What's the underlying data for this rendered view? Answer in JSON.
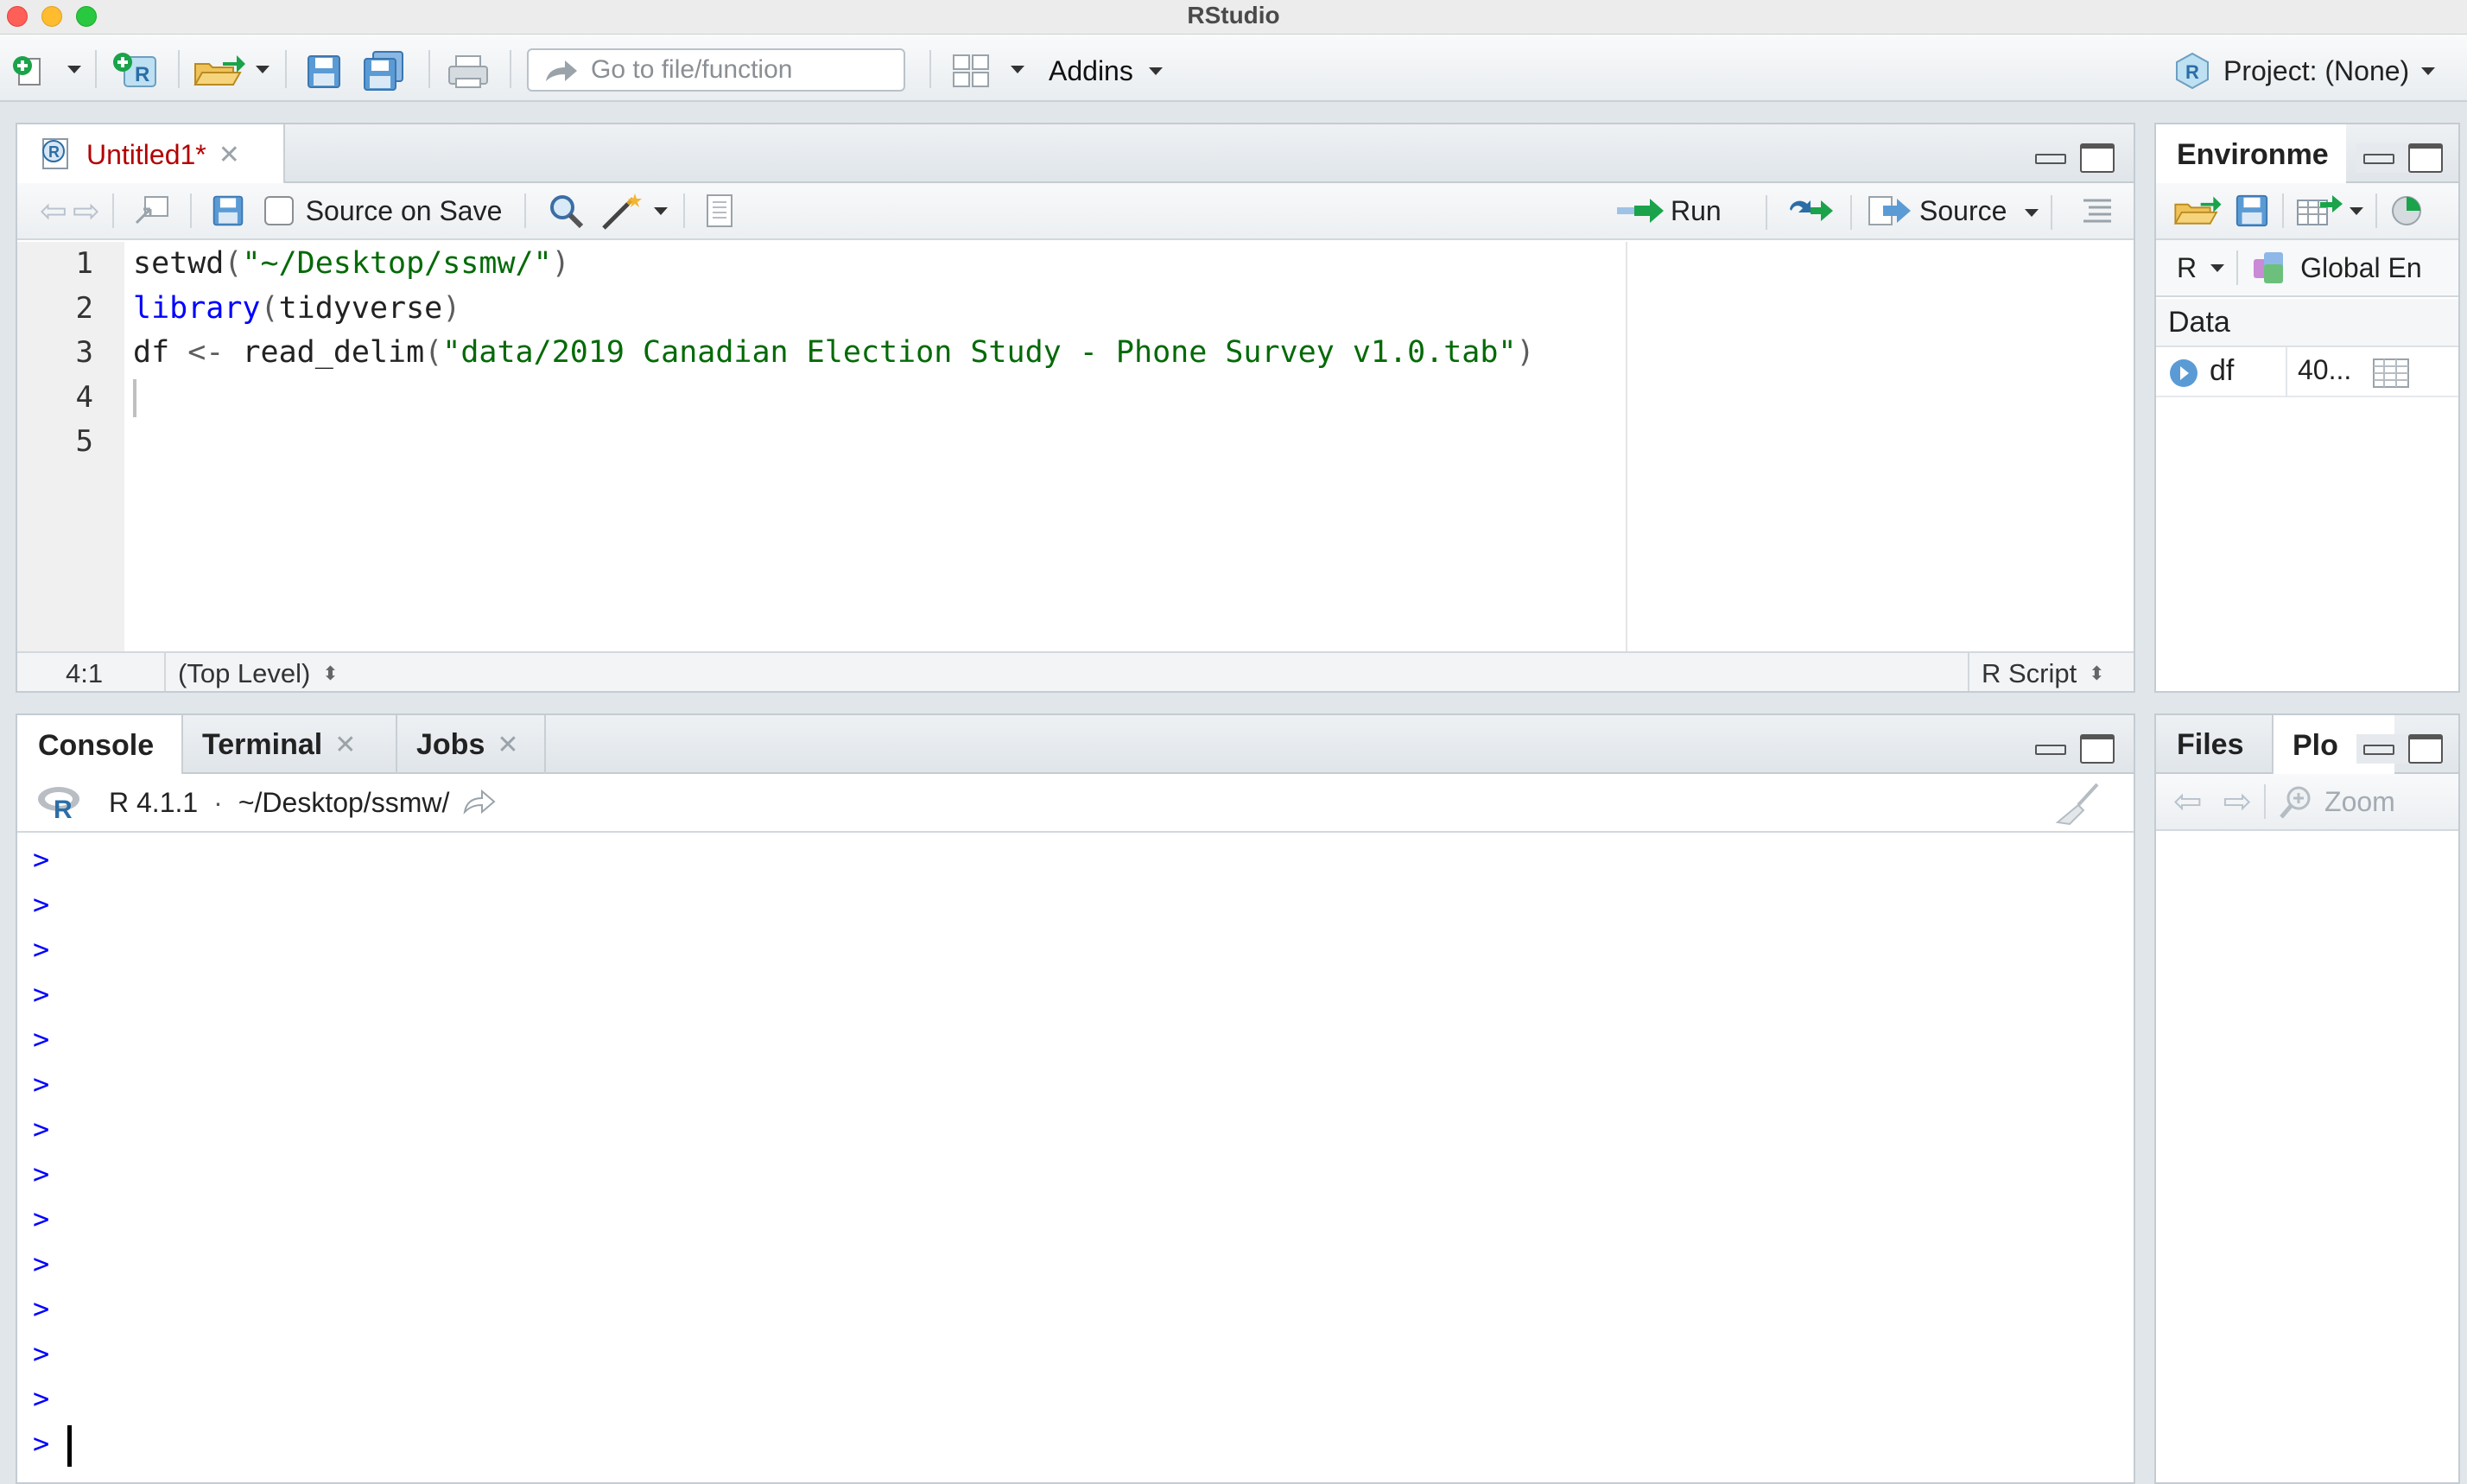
{
  "window": {
    "title": "RStudio"
  },
  "toolbar": {
    "goto_placeholder": "Go to file/function",
    "addins_label": "Addins",
    "project_label": "Project: (None)"
  },
  "editor": {
    "tab_label": "Untitled1*",
    "source_on_save_label": "Source on Save",
    "run_label": "Run",
    "source_label": "Source",
    "line_numbers": [
      "1",
      "2",
      "3",
      "4",
      "5"
    ],
    "code": {
      "l1_fn": "setwd",
      "l1_open": "(",
      "l1_str": "\"~/Desktop/ssmw/\"",
      "l1_close": ")",
      "l2_fn": "library",
      "l2_open": "(",
      "l2_arg": "tidyverse",
      "l2_close": ")",
      "l3_var": "df",
      "l3_assign": "<-",
      "l3_fn": "read_delim",
      "l3_open": "(",
      "l3_str": "\"data/2019 Canadian Election Study - Phone Survey v1.0.tab\"",
      "l3_close": ")"
    },
    "status_position": "4:1",
    "status_scope": "(Top Level)",
    "status_type": "R Script"
  },
  "environment": {
    "tab_label": "Environme",
    "lang_label": "R",
    "scope_label": "Global En",
    "section_label": "Data",
    "rows": [
      {
        "name": "df",
        "value": "40..."
      }
    ]
  },
  "console": {
    "tabs": {
      "console": "Console",
      "terminal": "Terminal",
      "jobs": "Jobs"
    },
    "r_version": "R 4.1.1",
    "separator": "·",
    "wd": "~/Desktop/ssmw/",
    "prompt": ">"
  },
  "files": {
    "tab_files": "Files",
    "tab_plots": "Plo",
    "zoom_label": "Zoom"
  },
  "colors": {
    "keyword": "#0000ff",
    "string": "#036a07",
    "prompt": "#0000ff",
    "tab_red": "#b30000"
  }
}
